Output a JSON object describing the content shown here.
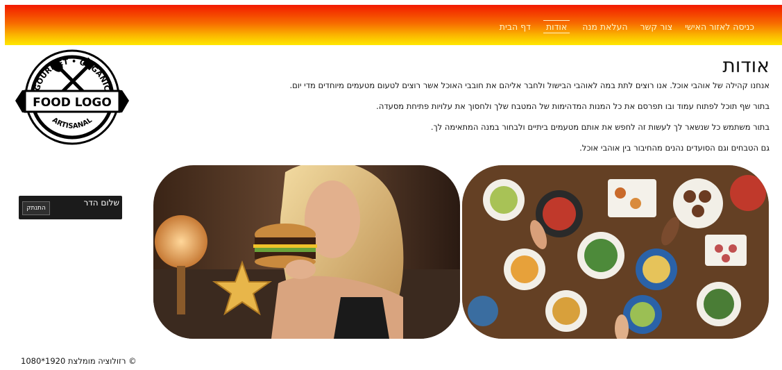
{
  "nav": {
    "items": [
      {
        "label": "דף הבית"
      },
      {
        "label": "אודות"
      },
      {
        "label": "העלאת מנה"
      },
      {
        "label": "צור קשר"
      },
      {
        "label": "כניסה לאזור האישי"
      }
    ],
    "active_index": 1
  },
  "logo": {
    "top_text": "GOURMET • ORGANIC",
    "main_text": "FOOD LOGO",
    "bottom_text": "ARTISANAL"
  },
  "about": {
    "title": "אודות",
    "paragraphs": [
      "אנחנו קהילה של אוהבי אוכל. אנו רוצים לתת במה לאוהבי הבישול ולחבר אליהם את חובבי האוכל אשר רוצים לטעום מטעמים מיוחדים מדי יום.",
      "בתור שף תוכל לפתוח עמוד ובו תפרסם את כל המנות המדהימות של המטבח שלך ולחסוך את עלויות פתיחת מסעדה.",
      "בתור משתמש כל שנשאר לך לעשות זה לחפש את אותם מטעמים ביתיים ולבחור במנה המתאימה לך.",
      "גם הטבחים וגם הסועדים נהנים מהחיבור בין אוהבי אוכל."
    ]
  },
  "user": {
    "greeting": "שלום הדר",
    "logout_label": "התנתק"
  },
  "footer": {
    "text": "© רזולוציה מומלצת 1920*1080"
  },
  "colors": {
    "nav_gradient_top": "#f21a00",
    "nav_gradient_bottom": "#ffe800",
    "nav_text": "#fff4cc",
    "user_box_bg": "#1b1b1b"
  }
}
